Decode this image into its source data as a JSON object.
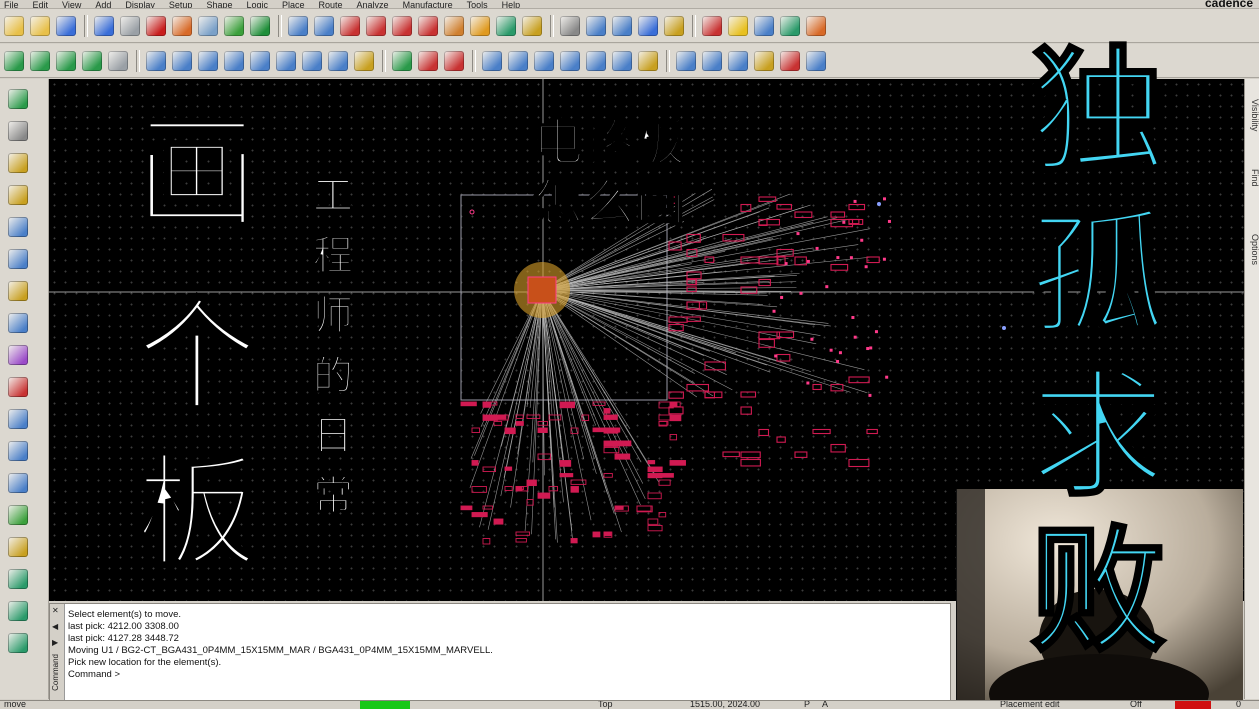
{
  "app": {
    "menu": [
      "File",
      "Edit",
      "View",
      "Add",
      "Display",
      "Setup",
      "Shape",
      "Logic",
      "Place",
      "Route",
      "Analyze",
      "Manufacture",
      "Tools",
      "Help"
    ],
    "brand": "cadence"
  },
  "toolbar1": {
    "icons": [
      "new-file-icon",
      "open-file-icon",
      "save-icon",
      "move-icon",
      "copy-icon",
      "delete-icon",
      "undo-icon",
      "redo-icon",
      "pin-icon",
      "unrats-icon",
      "grid-icon",
      "grid-toggle-icon",
      "zoom-fit-icon",
      "zoom-in-icon",
      "zoom-out-icon",
      "zoom-world-icon",
      "redraw-icon",
      "3d-view-icon",
      "layers-icon",
      "color-icon",
      "shadow-icon",
      "stats-icon",
      "report-icon",
      "info-icon",
      "constraint-icon",
      "paint-icon",
      "highlight-icon",
      "drc-icon",
      "spread-icon",
      "export-icon"
    ],
    "colors": [
      "#e8c04a",
      "#e8c04a",
      "#3a6ed8",
      "#3a6ed8",
      "#9aa0a6",
      "#c81e1e",
      "#d86a28",
      "#7aa0c8",
      "#3ca03c",
      "#1f8f3a",
      "#4a7fc8",
      "#4a7fc8",
      "#c83232",
      "#c83232",
      "#c83232",
      "#c83232",
      "#d08030",
      "#e09a20",
      "#2a9a6a",
      "#c8a020",
      "#888888",
      "#4a7fc8",
      "#4a7fc8",
      "#3a6ed8",
      "#c8a020",
      "#c83232",
      "#e8c020",
      "#4a7fc8",
      "#2a9a6a",
      "#d86a28"
    ]
  },
  "toolbar2": {
    "icons": [
      "place-manual-icon",
      "place-quick-icon",
      "place-auto-icon",
      "swap-icon",
      "group-icon",
      "line-icon",
      "rect-icon",
      "circle-icon",
      "shape-icon",
      "void-icon",
      "frame-icon",
      "via-icon",
      "fanout-icon",
      "bus-icon",
      "component-icon",
      "dimension-icon",
      "measure-icon",
      "route-icon",
      "slide-icon",
      "delay-icon",
      "spacing-icon",
      "add-connect-icon",
      "net-icon",
      "bundle-icon",
      "assign-icon",
      "wave-icon",
      "text-icon",
      "lock-icon",
      "check-icon",
      "image-icon"
    ],
    "colors": [
      "#2a9a4a",
      "#2a9a4a",
      "#2a9a4a",
      "#2a9a4a",
      "#9aa0a6",
      "#4a7fc8",
      "#4a7fc8",
      "#4a7fc8",
      "#4a7fc8",
      "#4a7fc8",
      "#4a7fc8",
      "#4a7fc8",
      "#4a7fc8",
      "#c8a020",
      "#2a9a4a",
      "#c83232",
      "#c83232",
      "#4a7fc8",
      "#4a7fc8",
      "#4a7fc8",
      "#4a7fc8",
      "#4a7fc8",
      "#4a7fc8",
      "#c8a020",
      "#4a7fc8",
      "#4a7fc8",
      "#4a7fc8",
      "#c8a020",
      "#c83232",
      "#4a7fc8"
    ]
  },
  "lefttoolbar": {
    "icons": [
      "place-part-icon",
      "add-pin-icon",
      "swap-pin-icon",
      "connect-icon",
      "route-bus-icon",
      "slide-route-icon",
      "fanout-route-icon",
      "delay-tune-icon",
      "spread-icon",
      "pad-icon",
      "wave-icon",
      "line-draw-icon",
      "rect-draw-icon",
      "text-add-icon",
      "label-icon",
      "diff-pair-icon",
      "auto-route-icon",
      "trace-icon"
    ]
  },
  "rightpanel": {
    "tabs": [
      "Visibility",
      "Find",
      "Options"
    ]
  },
  "overlay": {
    "title_left": "画个板",
    "subtitle": "工程师的日常",
    "title_mid_line1": "电路板",
    "title_mid_line2": "怎么画",
    "title_right": "独孤求败"
  },
  "command": {
    "label": "Command",
    "lines": [
      "Select element(s) to move.",
      "last pick:  4212.00  3308.00",
      "last pick:  4127.28  3448.72",
      "Moving U1 / BG2-CT_BGA431_0P4MM_15X15MM_MAR / BGA431_0P4MM_15X15MM_MARVELL.",
      "Pick new location for the element(s).",
      "Command >"
    ]
  },
  "status": {
    "mode": "move",
    "layer": "Top",
    "coords": "1515.00, 2024.00",
    "p_label": "P",
    "a_label": "A",
    "edit_mode": "Placement edit",
    "drc": "Off",
    "zero": "0"
  },
  "colors": {
    "canvas_bg": "#000000",
    "pcb_red": "#d11a52",
    "pcb_pink": "#ff3a8a",
    "rats": "#bcbcbc",
    "cursor": "#9a9a9a",
    "highlight": "#d8a02a",
    "title_cyan": "#43d6f3"
  }
}
